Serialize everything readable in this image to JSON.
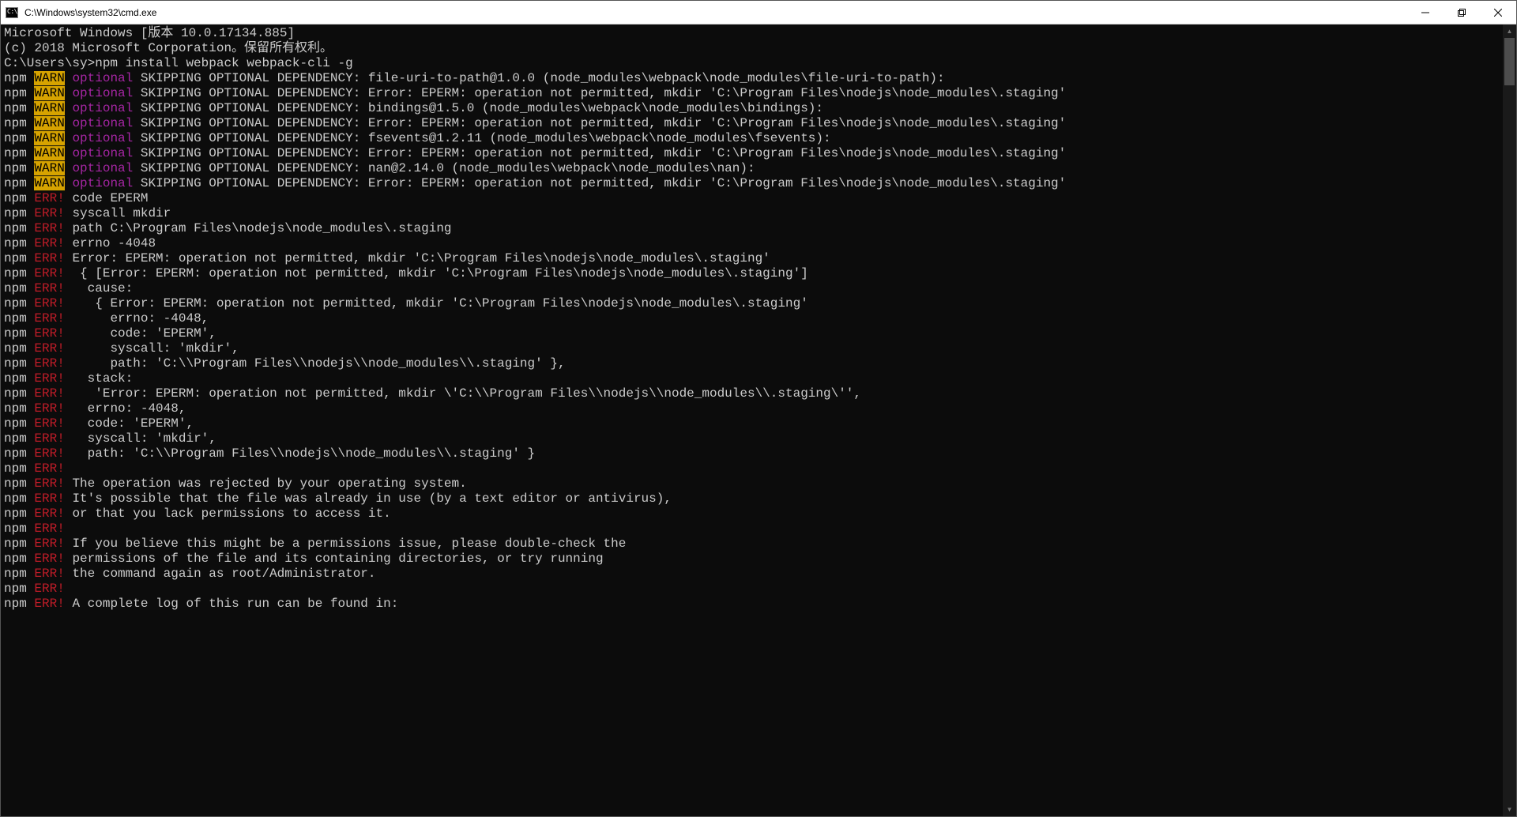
{
  "window": {
    "title": "C:\\Windows\\system32\\cmd.exe",
    "icon_semantic": "cmd-icon"
  },
  "terminal": {
    "header_lines": [
      "Microsoft Windows [版本 10.0.17134.885]",
      "(c) 2018 Microsoft Corporation。保留所有权利。",
      ""
    ],
    "prompt": "C:\\Users\\sy>",
    "command": "npm install webpack webpack-cli -g",
    "warn_lines": [
      "SKIPPING OPTIONAL DEPENDENCY: file-uri-to-path@1.0.0 (node_modules\\webpack\\node_modules\\file-uri-to-path):",
      "SKIPPING OPTIONAL DEPENDENCY: Error: EPERM: operation not permitted, mkdir 'C:\\Program Files\\nodejs\\node_modules\\.staging'",
      "SKIPPING OPTIONAL DEPENDENCY: bindings@1.5.0 (node_modules\\webpack\\node_modules\\bindings):",
      "SKIPPING OPTIONAL DEPENDENCY: Error: EPERM: operation not permitted, mkdir 'C:\\Program Files\\nodejs\\node_modules\\.staging'",
      "SKIPPING OPTIONAL DEPENDENCY: fsevents@1.2.11 (node_modules\\webpack\\node_modules\\fsevents):",
      "SKIPPING OPTIONAL DEPENDENCY: Error: EPERM: operation not permitted, mkdir 'C:\\Program Files\\nodejs\\node_modules\\.staging'",
      "SKIPPING OPTIONAL DEPENDENCY: nan@2.14.0 (node_modules\\webpack\\node_modules\\nan):",
      "SKIPPING OPTIONAL DEPENDENCY: Error: EPERM: operation not permitted, mkdir 'C:\\Program Files\\nodejs\\node_modules\\.staging'"
    ],
    "tokens": {
      "npm": "npm",
      "warn": "WARN",
      "optional": "optional",
      "err": "ERR!"
    },
    "err_lines": [
      "code EPERM",
      "syscall mkdir",
      "path C:\\Program Files\\nodejs\\node_modules\\.staging",
      "errno -4048",
      "Error: EPERM: operation not permitted, mkdir 'C:\\Program Files\\nodejs\\node_modules\\.staging'",
      " { [Error: EPERM: operation not permitted, mkdir 'C:\\Program Files\\nodejs\\node_modules\\.staging']",
      "  cause:",
      "   { Error: EPERM: operation not permitted, mkdir 'C:\\Program Files\\nodejs\\node_modules\\.staging'",
      "     errno: -4048,",
      "     code: 'EPERM',",
      "     syscall: 'mkdir',",
      "     path: 'C:\\\\Program Files\\\\nodejs\\\\node_modules\\\\.staging' },",
      "  stack:",
      "   'Error: EPERM: operation not permitted, mkdir \\'C:\\\\Program Files\\\\nodejs\\\\node_modules\\\\.staging\\'',",
      "  errno: -4048,",
      "  code: 'EPERM',",
      "  syscall: 'mkdir',",
      "  path: 'C:\\\\Program Files\\\\nodejs\\\\node_modules\\\\.staging' }",
      "",
      "The operation was rejected by your operating system.",
      "It's possible that the file was already in use (by a text editor or antivirus),",
      "or that you lack permissions to access it.",
      "",
      "If you believe this might be a permissions issue, please double-check the",
      "permissions of the file and its containing directories, or try running",
      "the command again as root/Administrator.",
      "",
      "A complete log of this run can be found in:"
    ]
  }
}
